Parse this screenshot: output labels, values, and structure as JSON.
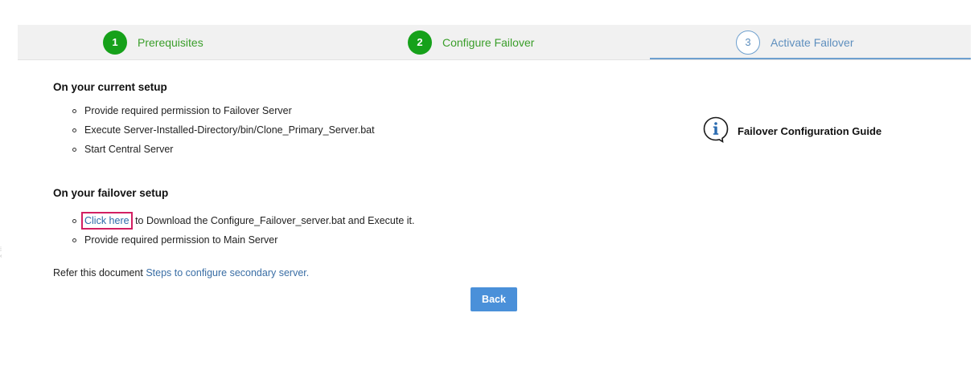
{
  "stepper": {
    "steps": [
      {
        "number": "1",
        "label": "Prerequisites",
        "state": "completed"
      },
      {
        "number": "2",
        "label": "Configure Failover",
        "state": "completed"
      },
      {
        "number": "3",
        "label": "Activate Failover",
        "state": "active"
      }
    ]
  },
  "current_setup": {
    "title": "On your current setup",
    "items": [
      "Provide required permission to Failover Server",
      "Execute Server-Installed-Directory/bin/Clone_Primary_Server.bat",
      "Start Central Server"
    ]
  },
  "failover_setup": {
    "title": "On your failover setup",
    "link_label": "Click here",
    "link_suffix": "to Download the Configure_Failover_server.bat and Execute it.",
    "items": [
      "Provide required permission to Main Server"
    ]
  },
  "refer": {
    "prefix": "Refer this document",
    "link_label": "Steps to configure secondary server."
  },
  "buttons": {
    "back_label": "Back"
  },
  "guide": {
    "icon": "info-speech-icon",
    "label": "Failover Configuration Guide"
  },
  "colors": {
    "completed": "#16a11a",
    "active": "#6ea0cf",
    "highlight_border": "#d21f62",
    "primary_button": "#4a90d9"
  }
}
